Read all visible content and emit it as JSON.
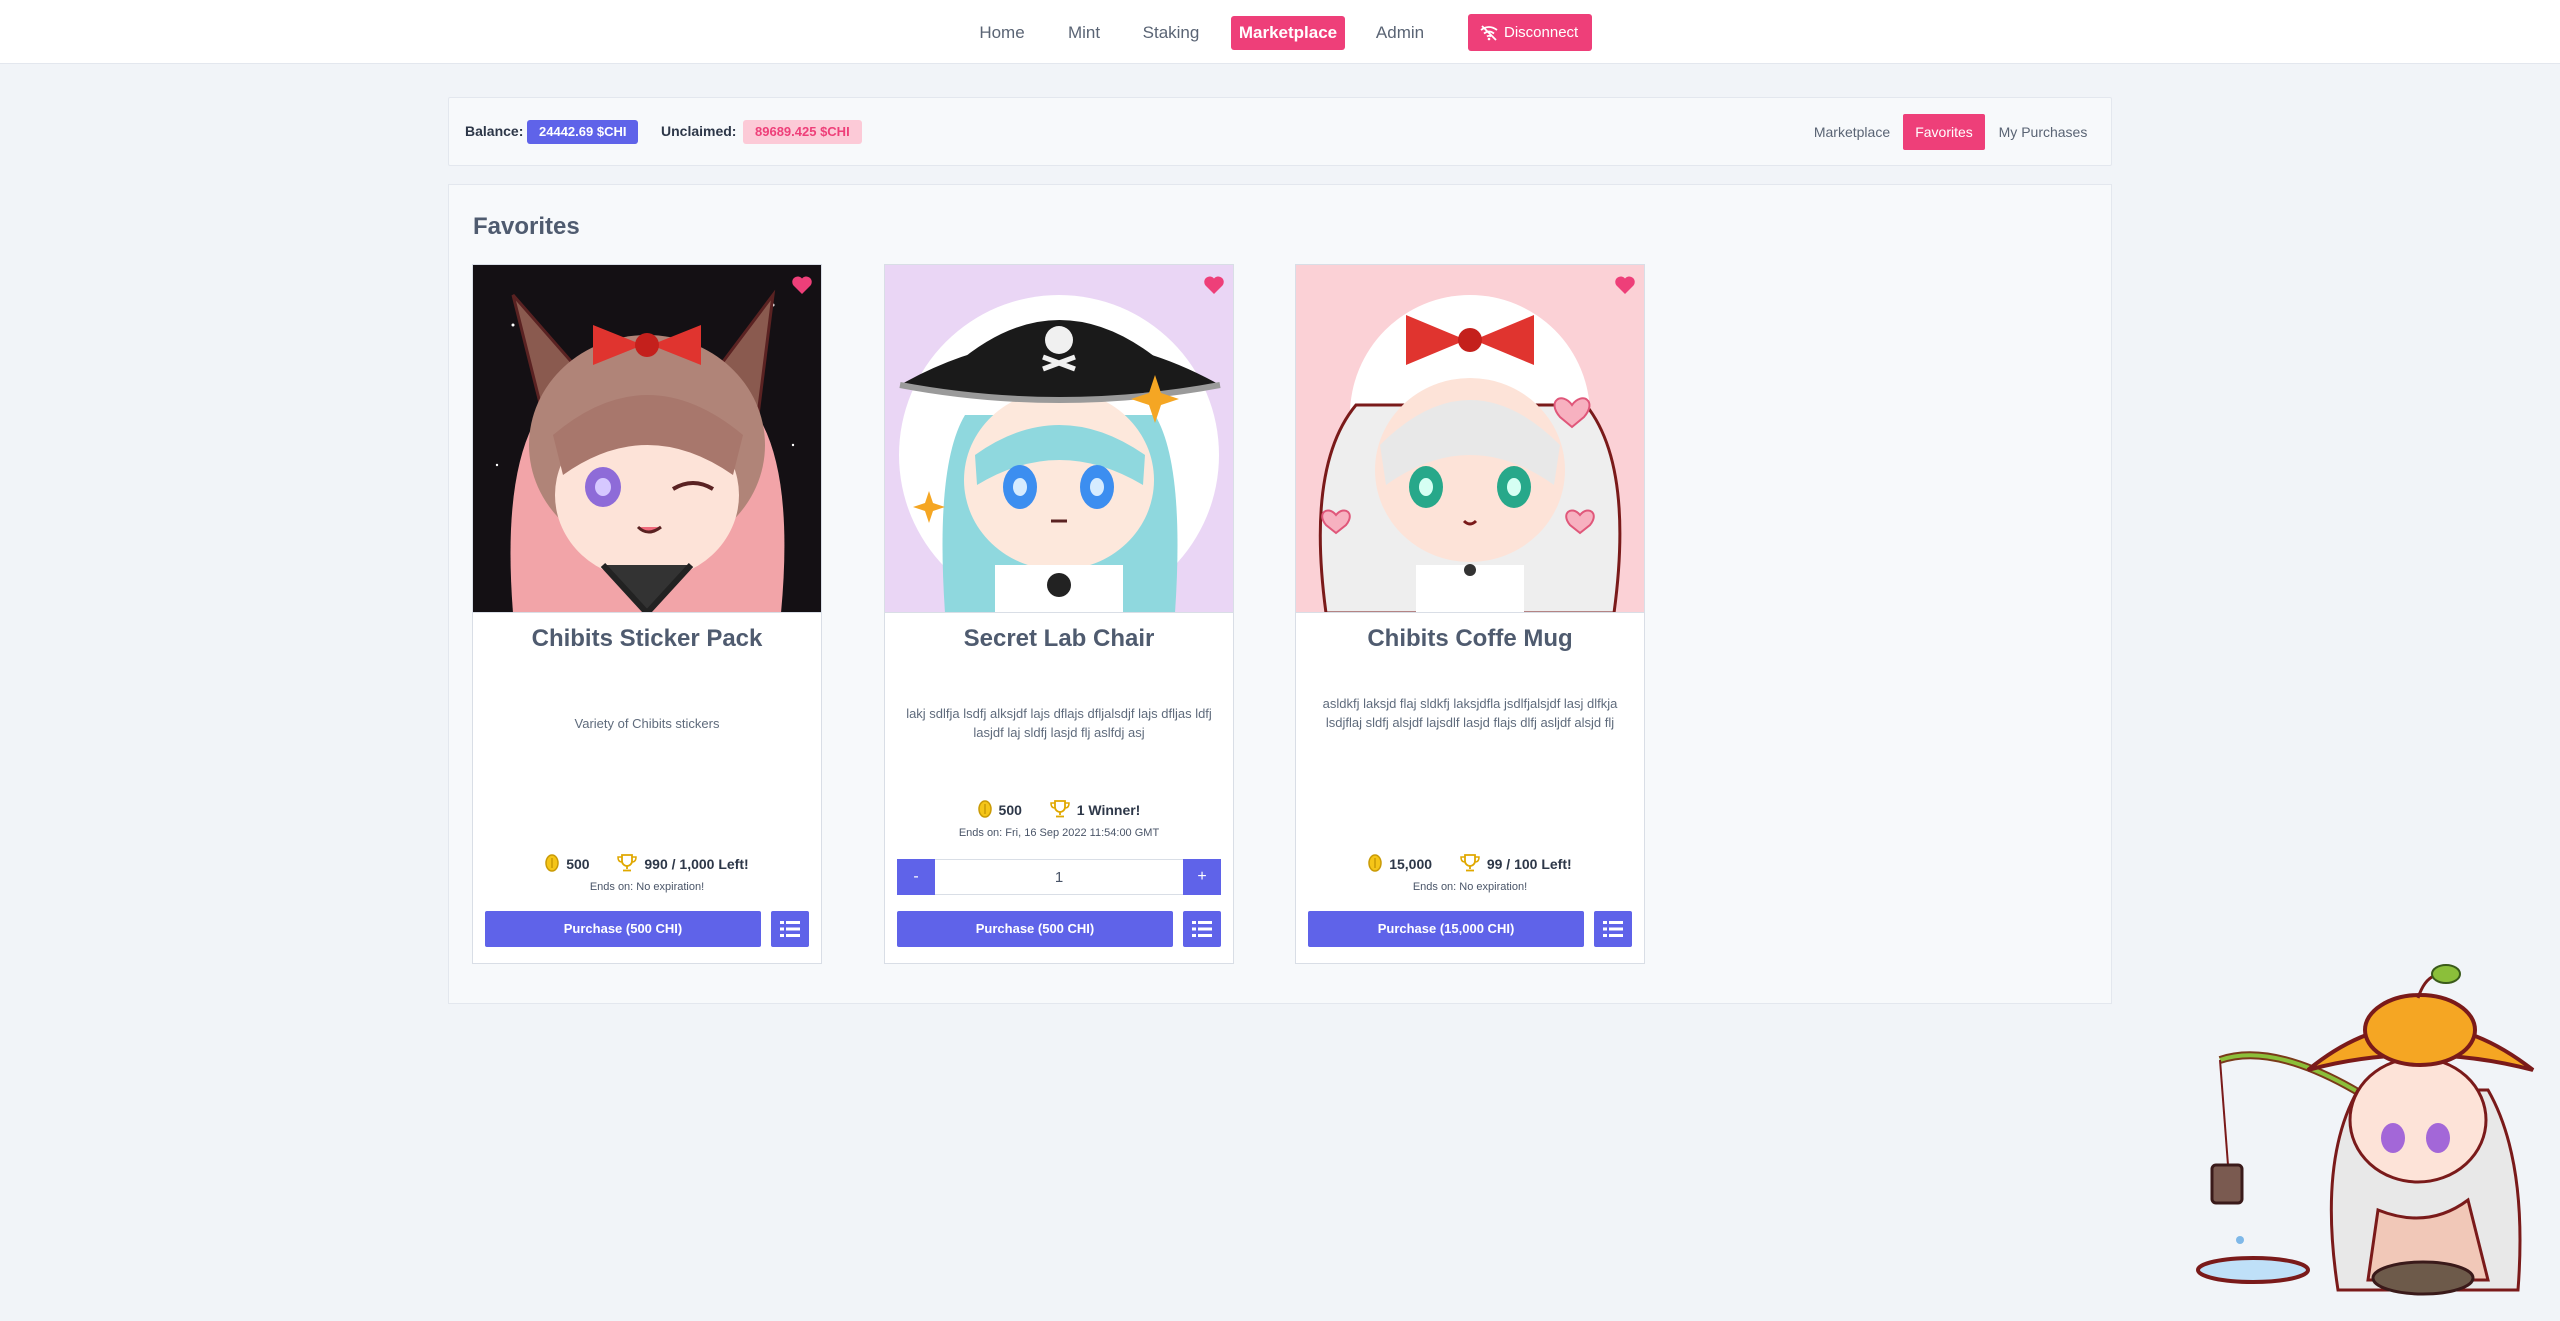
{
  "nav": {
    "items": [
      "Home",
      "Mint",
      "Staking",
      "Marketplace",
      "Admin"
    ],
    "active": "Marketplace",
    "disconnect_label": "Disconnect"
  },
  "balance_bar": {
    "balance_label": "Balance:",
    "balance_value": "24442.69 $CHI",
    "unclaimed_label": "Unclaimed:",
    "unclaimed_value": "89689.425 $CHI",
    "tabs": [
      "Marketplace",
      "Favorites",
      "My Purchases"
    ],
    "active_tab": "Favorites"
  },
  "panel": {
    "title": "Favorites"
  },
  "cards": [
    {
      "title": "Chibits Sticker Pack",
      "description": "Variety of Chibits stickers",
      "price": "500",
      "stock": "990 / 1,000 Left!",
      "ends": "Ends on: No expiration!",
      "purchase_label": "Purchase (500 CHI)",
      "favorited": true
    },
    {
      "title": "Secret Lab Chair",
      "description": "lakj sdlfja lsdfj alksjdf lajs dflajs dfljalsdjf lajs dfljas ldfj lasjdf laj sldfj lasjd flj aslfdj asj",
      "price": "500",
      "stock": "1 Winner!",
      "ends": "Ends on: Fri, 16 Sep 2022 11:54:00 GMT",
      "quantity": "1",
      "minus_label": "-",
      "plus_label": "+",
      "purchase_label": "Purchase (500 CHI)",
      "favorited": true
    },
    {
      "title": "Chibits Coffe Mug",
      "description": "asldkfj laksjd flaj sldkfj laksjdfla jsdlfjalsjdf lasj dlfkja lsdjflaj sldfj alsjdf lajsdlf lasjd flajs dlfj asljdf alsjd flj",
      "price": "15,000",
      "stock": "99 / 100 Left!",
      "ends": "Ends on: No expiration!",
      "purchase_label": "Purchase (15,000 CHI)",
      "favorited": true
    }
  ],
  "colors": {
    "accent_pink": "#ee3f79",
    "accent_blue": "#5f63e9",
    "background": "#f1f4f8"
  },
  "icons": {
    "disconnect": "wifi-off-icon",
    "favorite": "heart-icon",
    "price": "coin-icon",
    "stock": "trophy-icon",
    "details": "list-icon"
  }
}
